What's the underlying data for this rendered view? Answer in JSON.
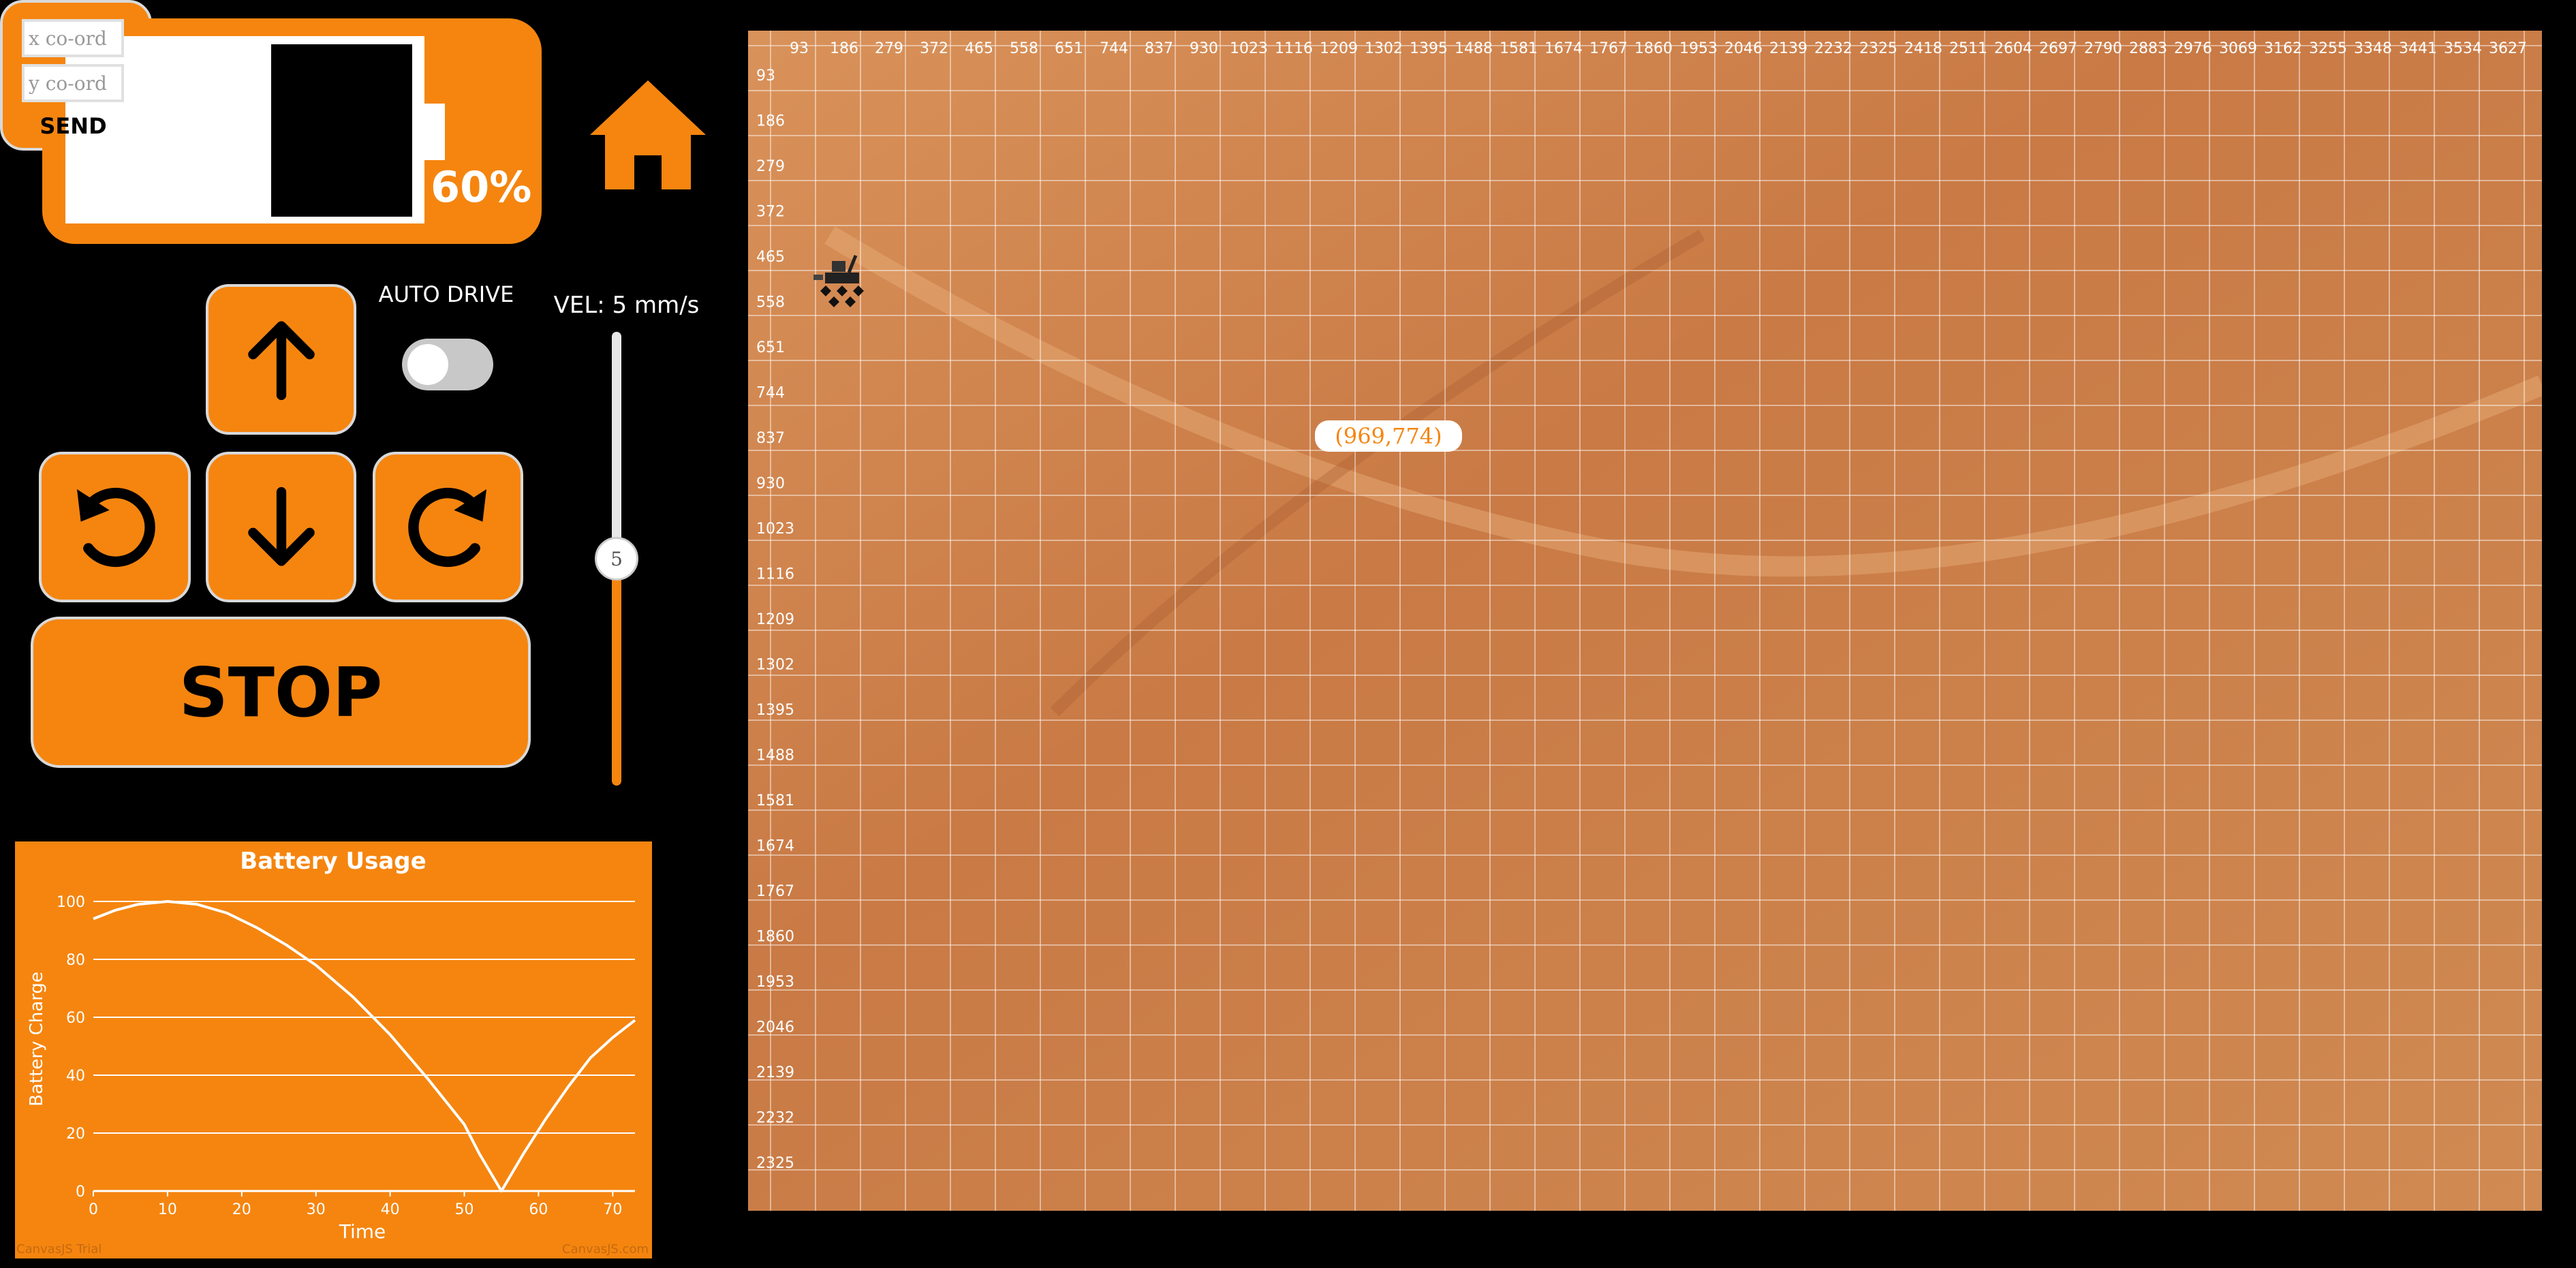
{
  "battery": {
    "percent_text": "60%",
    "level": 0.6
  },
  "controls": {
    "x_placeholder": "x co-ord",
    "y_placeholder": "y co-ord",
    "send_label": "SEND",
    "auto_drive_label": "AUTO DRIVE",
    "velocity_label": "VEL: 5 mm/s",
    "velocity_value": "5",
    "stop_label": "STOP"
  },
  "map": {
    "x_ticks": [
      "93",
      "186",
      "279",
      "372",
      "465",
      "558",
      "651",
      "744",
      "837",
      "930",
      "1023",
      "1116",
      "1209",
      "1302",
      "1395",
      "1488",
      "1581",
      "1674",
      "1767",
      "1860",
      "1953",
      "2046",
      "2139",
      "2232",
      "2325",
      "2418",
      "2511",
      "2604",
      "2697",
      "2790",
      "2883",
      "2976",
      "3069",
      "3162",
      "3255",
      "3348",
      "3441",
      "3534",
      "3627"
    ],
    "y_ticks": [
      "93",
      "186",
      "279",
      "372",
      "465",
      "558",
      "651",
      "744",
      "837",
      "930",
      "1023",
      "1116",
      "1209",
      "1302",
      "1395",
      "1488",
      "1581",
      "1674",
      "1767",
      "1860",
      "1953",
      "2046",
      "2139",
      "2232",
      "2325"
    ],
    "tooltip": "(969,774)"
  },
  "icons": [
    "home-icon",
    "arrow-up-icon",
    "arrow-down-icon",
    "rotate-left-icon",
    "rotate-right-icon",
    "rover-icon"
  ],
  "colors": {
    "accent": "#f5850f",
    "background": "#000000",
    "map": "#c97a45"
  },
  "chart_data": {
    "type": "line",
    "title": "Battery Usage",
    "xlabel": "Time",
    "ylabel": "Battery Charge",
    "x_ticks": [
      "0",
      "10",
      "20",
      "30",
      "40",
      "50",
      "60",
      "70"
    ],
    "y_ticks": [
      "0",
      "20",
      "40",
      "60",
      "80",
      "100"
    ],
    "xlim": [
      0,
      73
    ],
    "ylim": [
      0,
      100
    ],
    "grid": true,
    "series": [
      {
        "x": [
          0,
          3,
          6,
          10,
          14,
          18,
          22,
          26,
          30,
          35,
          40,
          45,
          50,
          52,
          55,
          58,
          61,
          64,
          67,
          70,
          73
        ],
        "y": [
          94,
          97,
          99,
          100,
          99,
          96,
          91,
          85,
          78,
          67,
          54,
          39,
          23,
          13,
          0,
          13,
          25,
          36,
          46,
          53,
          59
        ]
      }
    ],
    "watermark_left": "CanvasJS Trial",
    "watermark_right": "CanvasJS.com"
  }
}
